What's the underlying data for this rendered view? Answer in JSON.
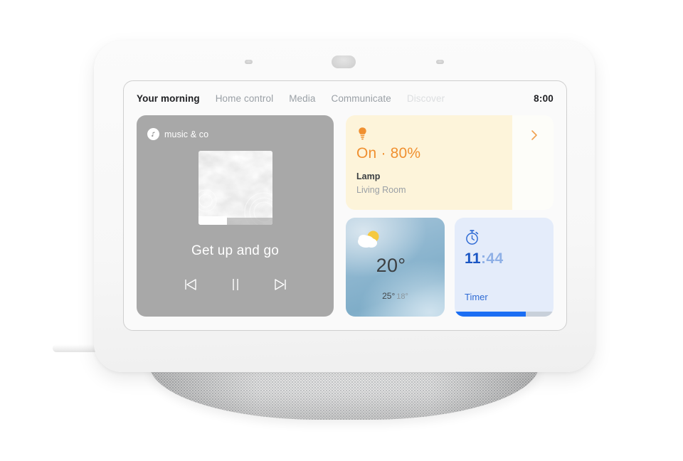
{
  "device": {
    "name": "smart-display",
    "sensors": [
      "sensor-dot-left",
      "ambient-light-sensor",
      "sensor-dot-right"
    ]
  },
  "nav": {
    "tabs": [
      {
        "label": "Your morning",
        "state": "active"
      },
      {
        "label": "Home control",
        "state": "normal"
      },
      {
        "label": "Media",
        "state": "normal"
      },
      {
        "label": "Communicate",
        "state": "normal"
      },
      {
        "label": "Discover",
        "state": "dim"
      }
    ],
    "clock": "8:00"
  },
  "music_card": {
    "source": "music & co",
    "source_icon": "music-note-icon",
    "title": "Get up and go",
    "controls": {
      "previous": "previous-track-icon",
      "pause": "pause-icon",
      "next": "next-track-icon"
    },
    "background_color": "#a8a8a8"
  },
  "lamp_card": {
    "icon": "light-bulb-icon",
    "state_line": "On · 80%",
    "name": "Lamp",
    "room": "Living Room",
    "chevron": "chevron-right-icon",
    "brightness_percent": 80,
    "accent_color": "#f09030",
    "fill_color": "#fdf4da"
  },
  "weather_card": {
    "icon": "sun-behind-cloud-icon",
    "temperature": "20°",
    "high": "25°",
    "low": "18°"
  },
  "timer_card": {
    "icon": "stopwatch-icon",
    "minutes": "11",
    "separator_seconds": ":44",
    "label": "Timer",
    "progress_percent": 72,
    "accent_color": "#1b6ef3"
  }
}
